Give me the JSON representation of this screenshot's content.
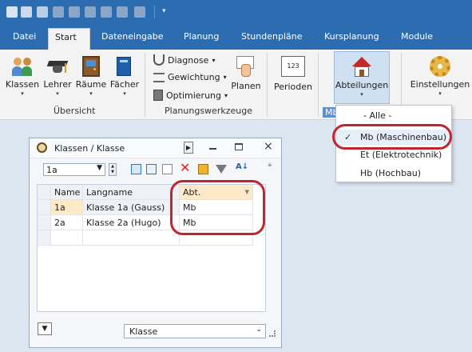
{
  "ribbon_tabs": [
    "Datei",
    "Start",
    "Dateneingabe",
    "Planung",
    "Stundenpläne",
    "Kursplanung",
    "Module"
  ],
  "ribbon": {
    "klassen": "Klassen",
    "lehrer": "Lehrer",
    "raeume": "Räume",
    "faecher": "Fächer",
    "uebersicht": "Übersicht",
    "diagnose": "Diagnose",
    "gewichtung": "Gewichtung",
    "optimierung": "Optimierung",
    "planen": "Planen",
    "planungswerkzeuge": "Planungswerkzeuge",
    "perioden": "Perioden",
    "abteilungen": "Abteilungen",
    "abteilungen_group": "Mb",
    "einstellungen": "Einstellungen",
    "perioden_icon_text": "123"
  },
  "dropdown": {
    "items": [
      "- Alle -",
      "Mb (Maschinenbau)",
      "Et (Elektrotechnik)",
      "Hb (Hochbau)"
    ],
    "checked": "✓"
  },
  "window": {
    "title": "Klassen / Klasse",
    "selector_value": "1a",
    "columns": [
      "Name",
      "Langname",
      "Abt."
    ],
    "rows": [
      {
        "name": "1a",
        "langname": "Klasse 1a (Gauss)",
        "abt": "Mb"
      },
      {
        "name": "2a",
        "langname": "Klasse 2a (Hugo)",
        "abt": "Mb"
      }
    ],
    "footer_select": "Klasse"
  },
  "colors": {
    "accent": "#2b6db0",
    "highlight": "#c0262d",
    "selected_row": "#fbe9c8"
  }
}
